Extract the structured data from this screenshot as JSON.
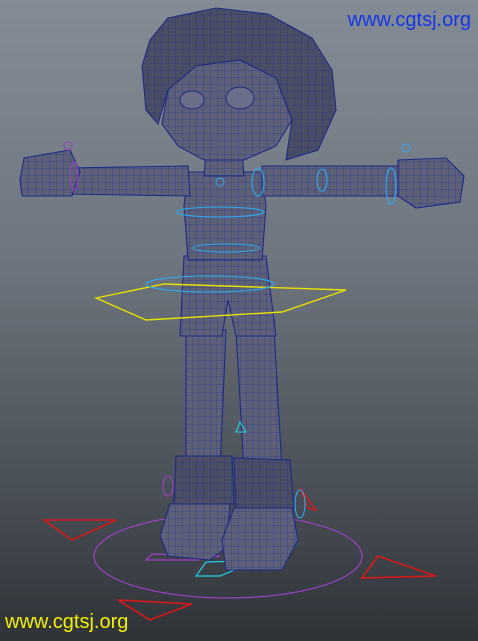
{
  "watermark_top": "www.cgtsj.org",
  "watermark_bottom": "www.cgtsj.org",
  "colors": {
    "background_top": "#838b94",
    "background_bottom": "#2f3338",
    "mesh_fill": "#5d6178",
    "wireframe": "#22309a",
    "ik_control": "#e8e000",
    "foot_control": "#22d0e0",
    "arm_control": "#30a8f0",
    "root_control": "#a040c8",
    "locator": "#d81818",
    "watermark_top": "#1536e8",
    "watermark_bottom": "#f4f000"
  },
  "icons": {
    "character_mesh": "character-mesh-icon",
    "locator": "triangle-locator-icon"
  }
}
